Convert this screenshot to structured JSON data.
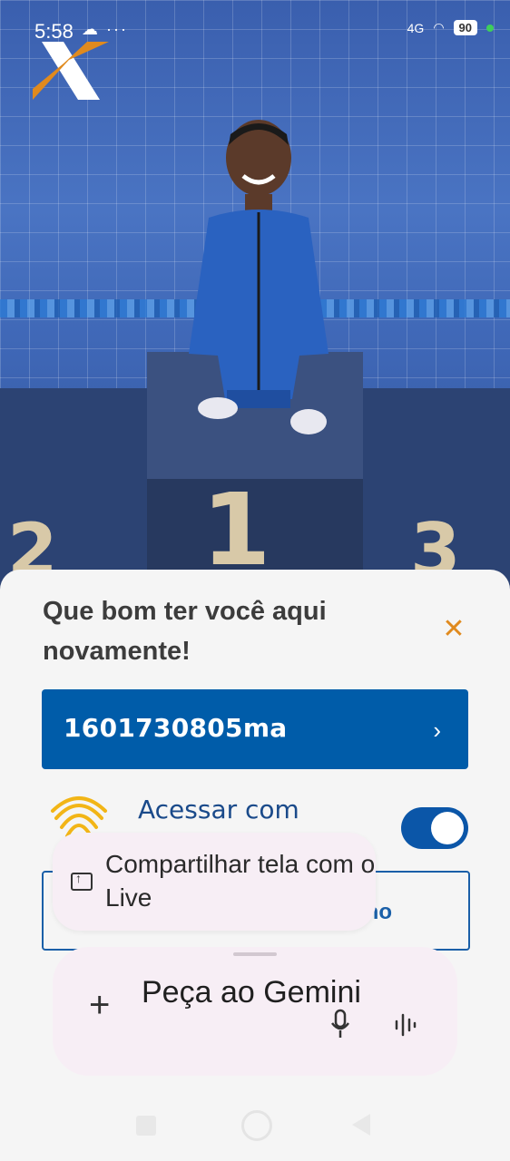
{
  "status_bar": {
    "time": "5:58",
    "icons": "☁ ···",
    "network": "4G",
    "battery": "90"
  },
  "hero": {
    "podium_numbers": [
      "2",
      "1",
      "3"
    ]
  },
  "sheet": {
    "welcome": "Que bom ter você aqui novamente!",
    "user_id": "1601730805ma",
    "access_label": "Acessar com",
    "biometric_toggle_on": true,
    "outline_button_partial_text": "no"
  },
  "share_popup": {
    "label": "Compartilhar tela com o Live"
  },
  "gemini": {
    "placeholder": "Peça ao Gemini"
  },
  "colors": {
    "brand_blue": "#005ca9",
    "accent_orange": "#e08a1e",
    "toggle_blue": "#0b56a8"
  }
}
